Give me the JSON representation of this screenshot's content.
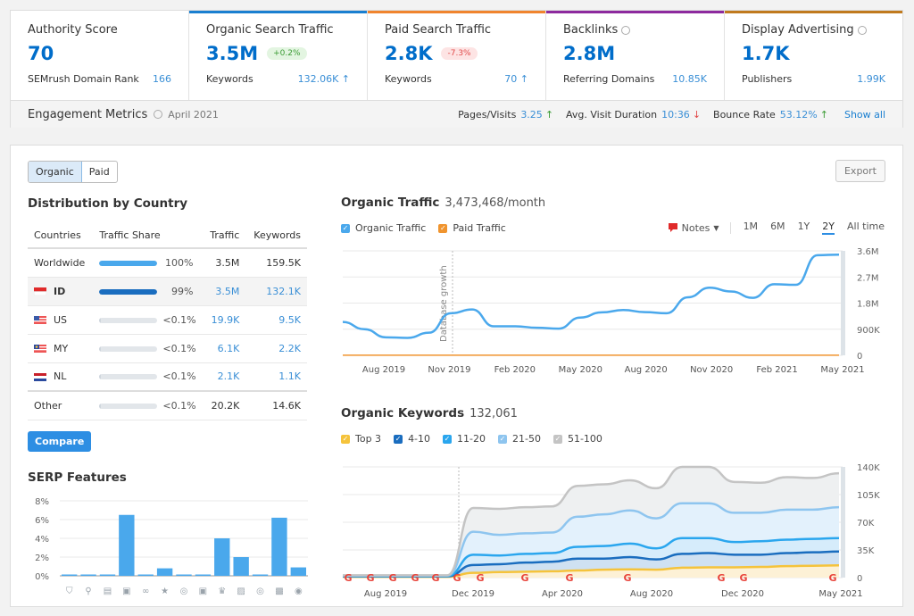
{
  "cards": [
    {
      "title": "Authority Score",
      "value": "70",
      "sub_label": "SEMrush Domain Rank",
      "sub_value": "166",
      "accent": "",
      "globe": false
    },
    {
      "title": "Organic Search Traffic",
      "value": "3.5M",
      "badge": "+0.2%",
      "badge_type": "up",
      "sub_label": "Keywords",
      "sub_value": "132.06K ↑",
      "accent": "#1a7fd0",
      "globe": false
    },
    {
      "title": "Paid Search Traffic",
      "value": "2.8K",
      "badge": "-7.3%",
      "badge_type": "down",
      "sub_label": "Keywords",
      "sub_value": "70 ↑",
      "accent": "#f0842e",
      "globe": false
    },
    {
      "title": "Backlinks",
      "value": "2.8M",
      "sub_label": "Referring Domains",
      "sub_value": "10.85K",
      "accent": "#8d2a9e",
      "globe": true
    },
    {
      "title": "Display Advertising",
      "value": "1.7K",
      "sub_label": "Publishers",
      "sub_value": "1.99K",
      "accent": "#c07a1e",
      "globe": true
    }
  ],
  "engagement": {
    "label": "Engagement Metrics",
    "date": "April 2021",
    "metrics": [
      {
        "label": "Pages/Visits",
        "value": "3.25",
        "trend": "↑"
      },
      {
        "label": "Avg. Visit Duration",
        "value": "10:36",
        "trend": "↓"
      },
      {
        "label": "Bounce Rate",
        "value": "53.12%",
        "trend": "↑"
      }
    ],
    "show_all": "Show all"
  },
  "toggle": {
    "organic": "Organic",
    "paid": "Paid"
  },
  "export": "Export",
  "distribution": {
    "title": "Distribution by Country",
    "headers": [
      "Countries",
      "Traffic Share",
      "Traffic",
      "Keywords"
    ],
    "rows": [
      {
        "country": "Worldwide",
        "share": 100,
        "share_label": "100%",
        "traffic": "3.5M",
        "keywords": "159.5K",
        "flag": "",
        "bar_color": "#4aa8ec"
      },
      {
        "country": "ID",
        "share": 99,
        "share_label": "99%",
        "traffic": "3.5M",
        "keywords": "132.1K",
        "flag": "id",
        "bar_color": "#1a6dbf"
      },
      {
        "country": "US",
        "share": 0.05,
        "share_label": "<0.1%",
        "traffic": "19.9K",
        "keywords": "9.5K",
        "flag": "us",
        "bar_color": "#4aa8ec"
      },
      {
        "country": "MY",
        "share": 0.05,
        "share_label": "<0.1%",
        "traffic": "6.1K",
        "keywords": "2.2K",
        "flag": "my",
        "bar_color": "#4aa8ec"
      },
      {
        "country": "NL",
        "share": 0.05,
        "share_label": "<0.1%",
        "traffic": "2.1K",
        "keywords": "1.1K",
        "flag": "nl",
        "bar_color": "#4aa8ec"
      },
      {
        "country": "Other",
        "share": 0.05,
        "share_label": "<0.1%",
        "traffic": "20.2K",
        "keywords": "14.6K",
        "flag": "",
        "bar_color": "#4aa8ec"
      }
    ],
    "compare": "Compare"
  },
  "serp": {
    "title": "SERP Features",
    "y_ticks": [
      "0%",
      "2%",
      "4%",
      "6%",
      "8%"
    ],
    "values": [
      0.1,
      0.1,
      0.1,
      6.5,
      0.1,
      0.8,
      0.1,
      0.1,
      4.0,
      2.0,
      0.1,
      6.2,
      0.9
    ],
    "icons": [
      "graduation-cap-icon",
      "map-pin-icon",
      "news-icon",
      "image-pack-icon",
      "link-icon",
      "star-icon",
      "video-icon",
      "video-carousel-icon",
      "crown-icon",
      "image-icon",
      "play-icon",
      "faq-icon",
      "question-icon"
    ]
  },
  "organic_traffic": {
    "title": "Organic Traffic",
    "value": "3,473,468/month",
    "legend": [
      {
        "label": "Organic Traffic",
        "color": "#4aa8ec"
      },
      {
        "label": "Paid Traffic",
        "color": "#f0942e"
      }
    ],
    "notes": "Notes",
    "ranges": [
      "1M",
      "6M",
      "1Y",
      "2Y",
      "All time"
    ],
    "active_range": "2Y"
  },
  "organic_keywords": {
    "title": "Organic Keywords",
    "value": "132,061",
    "legend": [
      {
        "label": "Top 3",
        "color": "#f5c33b"
      },
      {
        "label": "4-10",
        "color": "#1a6dbf"
      },
      {
        "label": "11-20",
        "color": "#2aa6ee"
      },
      {
        "label": "21-50",
        "color": "#8ec5ef"
      },
      {
        "label": "51-100",
        "color": "#c4c4c4"
      }
    ]
  },
  "chart_data": [
    {
      "type": "line",
      "title": "Organic Traffic",
      "x_ticks": [
        "Aug 2019",
        "Nov 2019",
        "Feb 2020",
        "May 2020",
        "Aug 2020",
        "Nov 2020",
        "Feb 2021",
        "May 2021"
      ],
      "y_ticks": [
        "0",
        "900K",
        "1.8M",
        "2.7M",
        "3.6M"
      ],
      "ylim": [
        0,
        3600000
      ],
      "annotation": "Database growth",
      "series": [
        {
          "name": "Organic Traffic",
          "color": "#4aa8ec",
          "values": [
            1150000,
            900000,
            620000,
            600000,
            780000,
            1450000,
            1580000,
            1000000,
            1000000,
            950000,
            920000,
            1300000,
            1480000,
            1560000,
            1490000,
            1450000,
            2000000,
            2330000,
            2200000,
            1980000,
            2450000,
            2430000,
            3450000,
            3470000
          ]
        },
        {
          "name": "Paid Traffic",
          "color": "#f0942e",
          "values": [
            2800,
            2800,
            2800,
            2800,
            2800,
            2800,
            2800,
            2800,
            2800,
            2800,
            2800,
            2800,
            2800,
            2800,
            2800,
            2800,
            2800,
            2800,
            2800,
            2800,
            2800,
            2800,
            2800,
            2800
          ]
        }
      ]
    },
    {
      "type": "area",
      "title": "Organic Keywords",
      "x_ticks": [
        "Aug 2019",
        "Dec 2019",
        "Apr 2020",
        "Aug 2020",
        "Dec 2020",
        "May 2021"
      ],
      "y_ticks": [
        "0",
        "35K",
        "70K",
        "105K",
        "140K"
      ],
      "ylim": [
        0,
        140000
      ],
      "series": [
        {
          "name": "Top 3",
          "color": "#f5c33b",
          "values": [
            1000,
            1000,
            1000,
            1000,
            1000,
            6000,
            7000,
            7500,
            8000,
            9000,
            10000,
            10500,
            10000,
            12500,
            13000,
            13000,
            13500,
            14500,
            15000,
            15500
          ]
        },
        {
          "name": "4-10",
          "color": "#1a6dbf",
          "values": [
            1500,
            1500,
            1500,
            1500,
            1500,
            16000,
            17000,
            19000,
            20000,
            24000,
            24000,
            26000,
            23000,
            30000,
            31000,
            29000,
            29000,
            31000,
            32000,
            33000
          ]
        },
        {
          "name": "11-20",
          "color": "#2aa6ee",
          "values": [
            2000,
            2000,
            2000,
            2000,
            2000,
            29000,
            28000,
            30000,
            31000,
            39000,
            40000,
            43000,
            37000,
            50000,
            50000,
            45000,
            46000,
            48000,
            49000,
            50000
          ]
        },
        {
          "name": "21-50",
          "color": "#8ec5ef",
          "values": [
            2500,
            2500,
            2500,
            2500,
            2500,
            58000,
            54000,
            56000,
            57000,
            77000,
            80000,
            85000,
            75000,
            94000,
            94000,
            82000,
            82000,
            86000,
            86000,
            89000
          ]
        },
        {
          "name": "51-100",
          "color": "#c4c4c4",
          "values": [
            3000,
            3000,
            3000,
            3000,
            3000,
            88000,
            87000,
            89000,
            90000,
            116000,
            118000,
            123000,
            113000,
            140000,
            140000,
            121000,
            120000,
            127000,
            126000,
            132000
          ]
        }
      ]
    },
    {
      "type": "bar",
      "title": "SERP Features",
      "categories": [
        "graduation-cap",
        "map-pin",
        "news",
        "image-pack",
        "link",
        "star",
        "video",
        "video-carousel",
        "crown",
        "image",
        "play",
        "faq",
        "question"
      ],
      "values": [
        0.1,
        0.1,
        0.1,
        6.5,
        0.1,
        0.8,
        0.1,
        0.1,
        4.0,
        2.0,
        0.1,
        6.2,
        0.9
      ],
      "ylim": [
        0,
        8
      ],
      "ylabel": "%"
    }
  ]
}
